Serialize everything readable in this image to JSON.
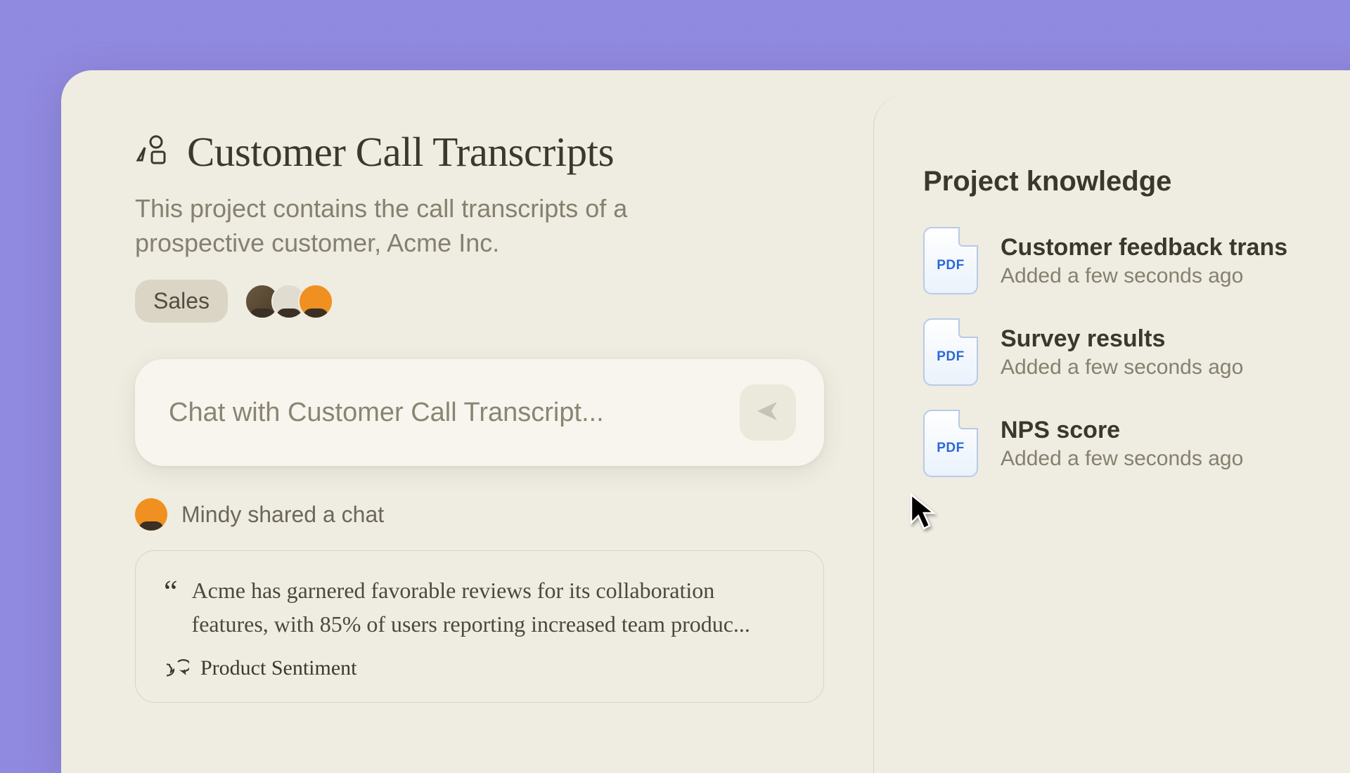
{
  "project": {
    "title": "Customer Call Transcripts",
    "description": "This project contains the call transcripts of a prospective customer, Acme Inc.",
    "tag": "Sales"
  },
  "chat": {
    "placeholder": "Chat with Customer Call Transcript..."
  },
  "shared": {
    "text": "Mindy shared a chat"
  },
  "card": {
    "quote": "Acme has garnered favorable reviews for its collaboration features, with 85% of users reporting increased team produc...",
    "footer_label": "Product Sentiment"
  },
  "sidebar": {
    "title": "Project knowledge",
    "files": [
      {
        "name": "Customer feedback trans",
        "time": "Added a few seconds ago",
        "badge": "PDF"
      },
      {
        "name": "Survey results",
        "time": "Added a few seconds ago",
        "badge": "PDF"
      },
      {
        "name": "NPS score",
        "time": "Added a few seconds ago",
        "badge": "PDF"
      }
    ]
  }
}
